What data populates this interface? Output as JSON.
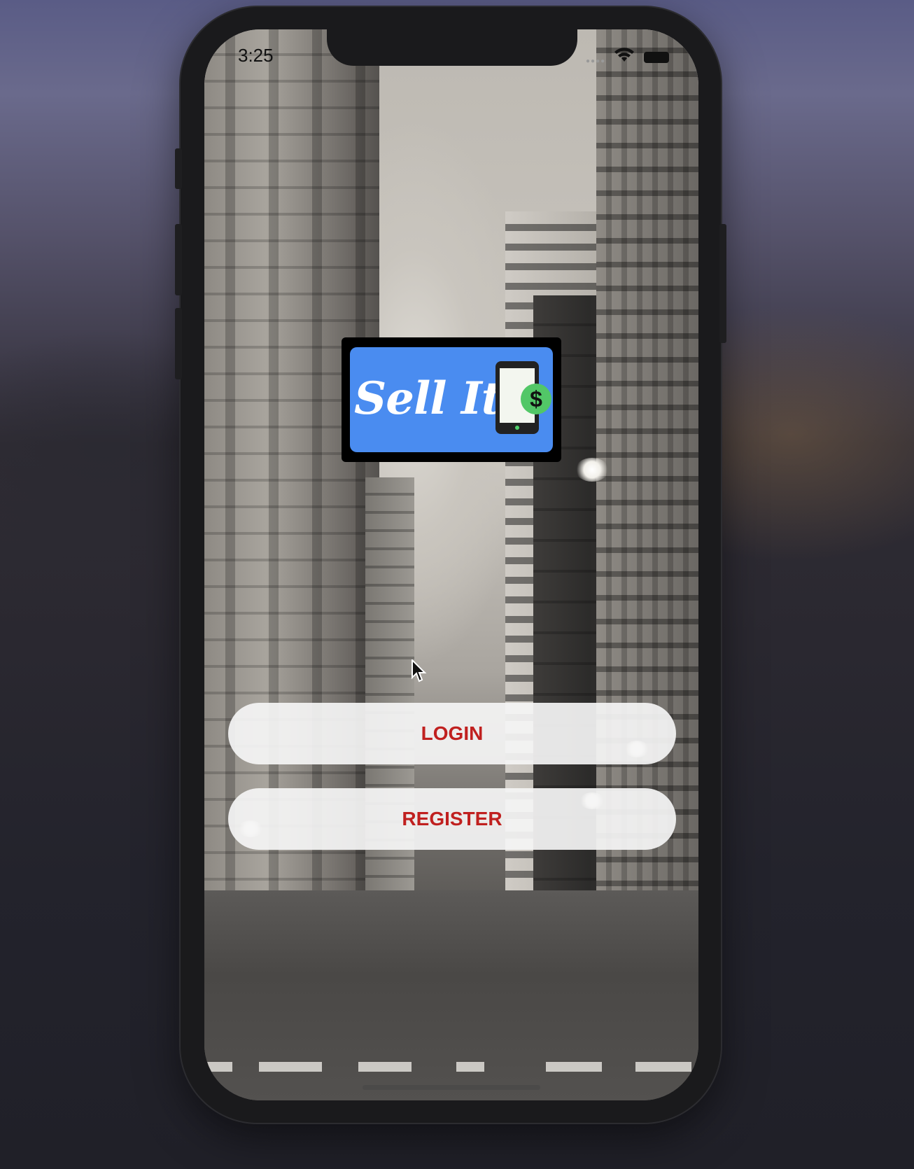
{
  "status_bar": {
    "time": "3:25"
  },
  "logo": {
    "text": "Sell It",
    "badge_symbol": "$",
    "background_color": "#4a8cf0"
  },
  "buttons": {
    "login_label": "LOGIN",
    "register_label": "REGISTER",
    "text_color": "#c0201f"
  },
  "icons": {
    "wifi": "wifi-icon",
    "battery": "battery-icon",
    "cursor": "mouse-cursor-icon"
  }
}
